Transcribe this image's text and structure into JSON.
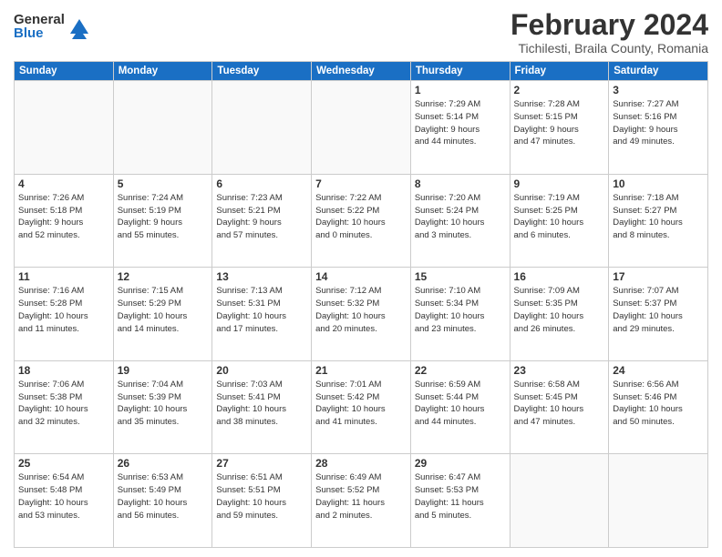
{
  "logo": {
    "general": "General",
    "blue": "Blue"
  },
  "title": "February 2024",
  "subtitle": "Tichilesti, Braila County, Romania",
  "days_of_week": [
    "Sunday",
    "Monday",
    "Tuesday",
    "Wednesday",
    "Thursday",
    "Friday",
    "Saturday"
  ],
  "weeks": [
    [
      {
        "day": "",
        "info": ""
      },
      {
        "day": "",
        "info": ""
      },
      {
        "day": "",
        "info": ""
      },
      {
        "day": "",
        "info": ""
      },
      {
        "day": "1",
        "info": "Sunrise: 7:29 AM\nSunset: 5:14 PM\nDaylight: 9 hours\nand 44 minutes."
      },
      {
        "day": "2",
        "info": "Sunrise: 7:28 AM\nSunset: 5:15 PM\nDaylight: 9 hours\nand 47 minutes."
      },
      {
        "day": "3",
        "info": "Sunrise: 7:27 AM\nSunset: 5:16 PM\nDaylight: 9 hours\nand 49 minutes."
      }
    ],
    [
      {
        "day": "4",
        "info": "Sunrise: 7:26 AM\nSunset: 5:18 PM\nDaylight: 9 hours\nand 52 minutes."
      },
      {
        "day": "5",
        "info": "Sunrise: 7:24 AM\nSunset: 5:19 PM\nDaylight: 9 hours\nand 55 minutes."
      },
      {
        "day": "6",
        "info": "Sunrise: 7:23 AM\nSunset: 5:21 PM\nDaylight: 9 hours\nand 57 minutes."
      },
      {
        "day": "7",
        "info": "Sunrise: 7:22 AM\nSunset: 5:22 PM\nDaylight: 10 hours\nand 0 minutes."
      },
      {
        "day": "8",
        "info": "Sunrise: 7:20 AM\nSunset: 5:24 PM\nDaylight: 10 hours\nand 3 minutes."
      },
      {
        "day": "9",
        "info": "Sunrise: 7:19 AM\nSunset: 5:25 PM\nDaylight: 10 hours\nand 6 minutes."
      },
      {
        "day": "10",
        "info": "Sunrise: 7:18 AM\nSunset: 5:27 PM\nDaylight: 10 hours\nand 8 minutes."
      }
    ],
    [
      {
        "day": "11",
        "info": "Sunrise: 7:16 AM\nSunset: 5:28 PM\nDaylight: 10 hours\nand 11 minutes."
      },
      {
        "day": "12",
        "info": "Sunrise: 7:15 AM\nSunset: 5:29 PM\nDaylight: 10 hours\nand 14 minutes."
      },
      {
        "day": "13",
        "info": "Sunrise: 7:13 AM\nSunset: 5:31 PM\nDaylight: 10 hours\nand 17 minutes."
      },
      {
        "day": "14",
        "info": "Sunrise: 7:12 AM\nSunset: 5:32 PM\nDaylight: 10 hours\nand 20 minutes."
      },
      {
        "day": "15",
        "info": "Sunrise: 7:10 AM\nSunset: 5:34 PM\nDaylight: 10 hours\nand 23 minutes."
      },
      {
        "day": "16",
        "info": "Sunrise: 7:09 AM\nSunset: 5:35 PM\nDaylight: 10 hours\nand 26 minutes."
      },
      {
        "day": "17",
        "info": "Sunrise: 7:07 AM\nSunset: 5:37 PM\nDaylight: 10 hours\nand 29 minutes."
      }
    ],
    [
      {
        "day": "18",
        "info": "Sunrise: 7:06 AM\nSunset: 5:38 PM\nDaylight: 10 hours\nand 32 minutes."
      },
      {
        "day": "19",
        "info": "Sunrise: 7:04 AM\nSunset: 5:39 PM\nDaylight: 10 hours\nand 35 minutes."
      },
      {
        "day": "20",
        "info": "Sunrise: 7:03 AM\nSunset: 5:41 PM\nDaylight: 10 hours\nand 38 minutes."
      },
      {
        "day": "21",
        "info": "Sunrise: 7:01 AM\nSunset: 5:42 PM\nDaylight: 10 hours\nand 41 minutes."
      },
      {
        "day": "22",
        "info": "Sunrise: 6:59 AM\nSunset: 5:44 PM\nDaylight: 10 hours\nand 44 minutes."
      },
      {
        "day": "23",
        "info": "Sunrise: 6:58 AM\nSunset: 5:45 PM\nDaylight: 10 hours\nand 47 minutes."
      },
      {
        "day": "24",
        "info": "Sunrise: 6:56 AM\nSunset: 5:46 PM\nDaylight: 10 hours\nand 50 minutes."
      }
    ],
    [
      {
        "day": "25",
        "info": "Sunrise: 6:54 AM\nSunset: 5:48 PM\nDaylight: 10 hours\nand 53 minutes."
      },
      {
        "day": "26",
        "info": "Sunrise: 6:53 AM\nSunset: 5:49 PM\nDaylight: 10 hours\nand 56 minutes."
      },
      {
        "day": "27",
        "info": "Sunrise: 6:51 AM\nSunset: 5:51 PM\nDaylight: 10 hours\nand 59 minutes."
      },
      {
        "day": "28",
        "info": "Sunrise: 6:49 AM\nSunset: 5:52 PM\nDaylight: 11 hours\nand 2 minutes."
      },
      {
        "day": "29",
        "info": "Sunrise: 6:47 AM\nSunset: 5:53 PM\nDaylight: 11 hours\nand 5 minutes."
      },
      {
        "day": "",
        "info": ""
      },
      {
        "day": "",
        "info": ""
      }
    ]
  ]
}
